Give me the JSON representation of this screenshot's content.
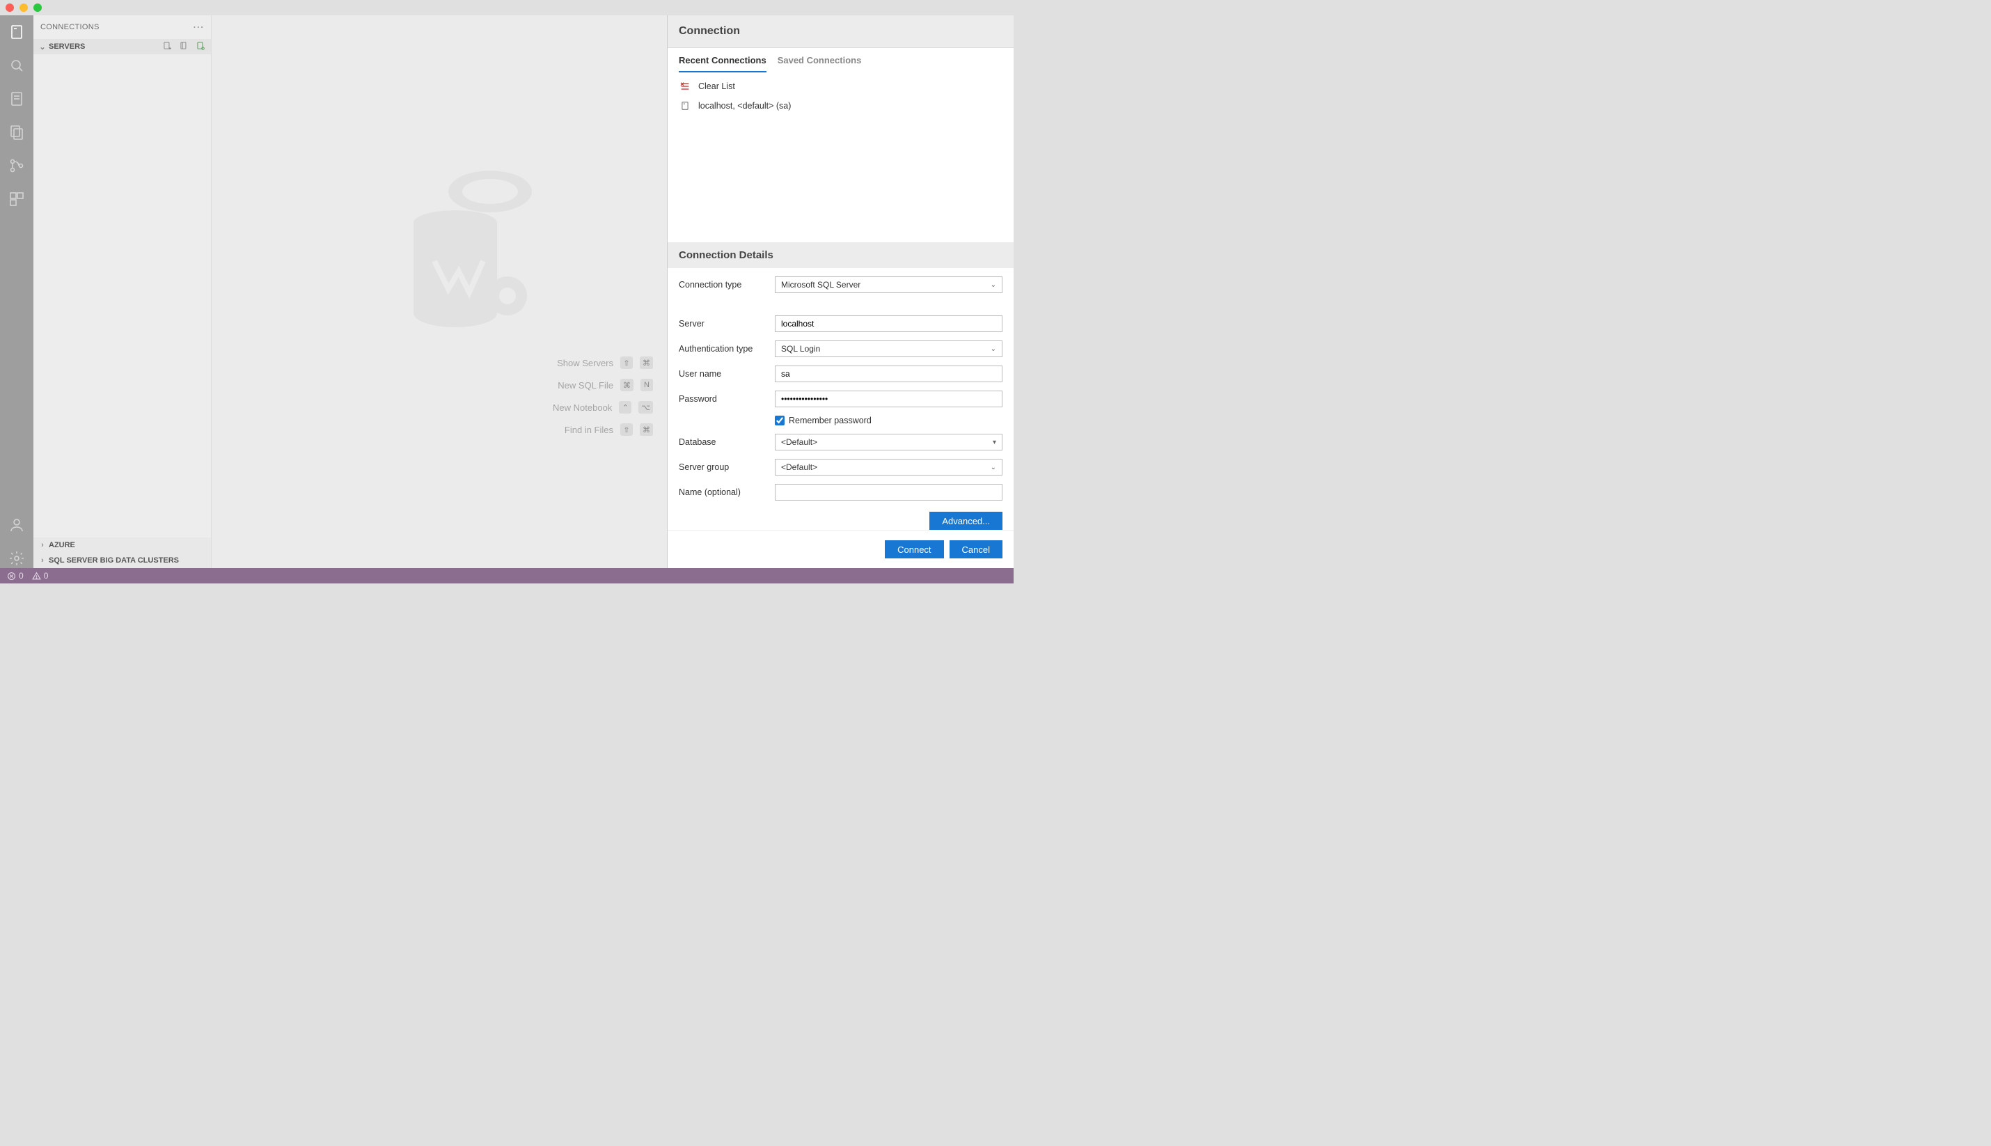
{
  "window": {
    "traffic_lights": [
      "close",
      "minimize",
      "zoom"
    ]
  },
  "activity_bar": {
    "items": [
      {
        "name": "connections",
        "active": true
      },
      {
        "name": "search",
        "active": false
      },
      {
        "name": "notebooks",
        "active": false
      },
      {
        "name": "explorer",
        "active": false
      },
      {
        "name": "source-control",
        "active": false
      },
      {
        "name": "extensions",
        "active": false
      }
    ],
    "bottom": [
      {
        "name": "accounts"
      },
      {
        "name": "settings"
      }
    ]
  },
  "sidebar": {
    "title": "CONNECTIONS",
    "sections": [
      {
        "label": "SERVERS",
        "expanded": true,
        "actions": [
          "new-connection",
          "new-group",
          "filter"
        ]
      },
      {
        "label": "AZURE",
        "expanded": false
      },
      {
        "label": "SQL SERVER BIG DATA CLUSTERS",
        "expanded": false
      }
    ]
  },
  "editor": {
    "shortcuts": [
      {
        "label": "Show Servers",
        "keys": [
          "⇧",
          "⌘"
        ]
      },
      {
        "label": "New SQL File",
        "keys": [
          "⌘",
          "N"
        ]
      },
      {
        "label": "New Notebook",
        "keys": [
          "⌃",
          "⌥"
        ]
      },
      {
        "label": "Find in Files",
        "keys": [
          "⇧",
          "⌘"
        ]
      }
    ]
  },
  "panel": {
    "title": "Connection",
    "tabs": [
      {
        "label": "Recent Connections",
        "active": true
      },
      {
        "label": "Saved Connections",
        "active": false
      }
    ],
    "recent": {
      "clear_label": "Clear List",
      "items": [
        {
          "label": "localhost, <default> (sa)"
        }
      ]
    },
    "details_title": "Connection Details",
    "form": {
      "connection_type": {
        "label": "Connection type",
        "value": "Microsoft SQL Server"
      },
      "server": {
        "label": "Server",
        "value": "localhost"
      },
      "auth_type": {
        "label": "Authentication type",
        "value": "SQL Login"
      },
      "user": {
        "label": "User name",
        "value": "sa"
      },
      "password": {
        "label": "Password",
        "value": "••••••••••••••••"
      },
      "remember": {
        "label": "Remember password",
        "checked": true
      },
      "database": {
        "label": "Database",
        "value": "<Default>"
      },
      "server_group": {
        "label": "Server group",
        "value": "<Default>"
      },
      "name": {
        "label": "Name (optional)",
        "value": ""
      }
    },
    "advanced_label": "Advanced...",
    "connect_label": "Connect",
    "cancel_label": "Cancel"
  },
  "statusbar": {
    "errors": 0,
    "warnings": 0
  }
}
